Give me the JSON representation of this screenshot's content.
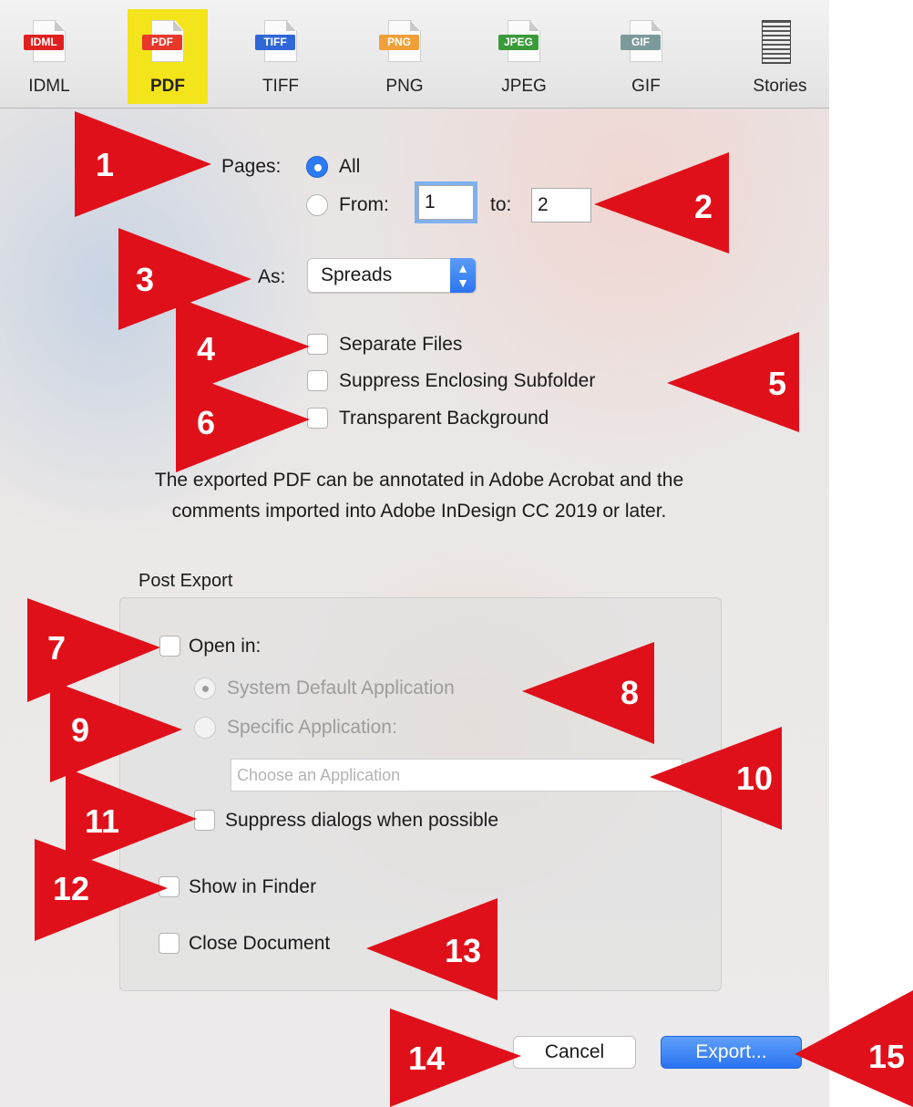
{
  "toolbar": {
    "items": [
      {
        "badge": "IDML",
        "badge_color": "#e0201f",
        "label": "IDML"
      },
      {
        "badge": "PDF",
        "badge_color": "#e8382a",
        "label": "PDF"
      },
      {
        "badge": "TIFF",
        "badge_color": "#2f67d8",
        "label": "TIFF"
      },
      {
        "badge": "PNG",
        "badge_color": "#f0a03a",
        "label": "PNG"
      },
      {
        "badge": "JPEG",
        "badge_color": "#3a9a3a",
        "label": "JPEG"
      },
      {
        "badge": "GIF",
        "badge_color": "#7d9a9a",
        "label": "GIF"
      },
      {
        "badge": "",
        "badge_color": "",
        "label": "Stories"
      }
    ],
    "selected": "PDF",
    "selected_color": "#f3e41b"
  },
  "pages": {
    "label": "Pages:",
    "all_label": "All",
    "from_label": "From:",
    "from_value": "1",
    "to_label": "to:",
    "to_value": "2",
    "selected": "All"
  },
  "as": {
    "label": "As:",
    "value": "Spreads"
  },
  "options": {
    "separate_files": "Separate Files",
    "suppress_subfolder": "Suppress Enclosing Subfolder",
    "transparent_bg": "Transparent Background"
  },
  "note": {
    "line1": "The exported PDF can be annotated in Adobe Acrobat and the",
    "line2": "comments imported into Adobe InDesign CC 2019 or later."
  },
  "post_export": {
    "title": "Post Export",
    "open_in": "Open in:",
    "system_default": "System Default Application",
    "specific_app": "Specific Application:",
    "app_placeholder": "Choose an Application",
    "suppress_dialogs": "Suppress dialogs when possible",
    "show_in_finder": "Show in Finder",
    "close_document": "Close Document"
  },
  "buttons": {
    "cancel": "Cancel",
    "export": "Export..."
  },
  "callouts": {
    "color": "#e0101a",
    "numbers": [
      "1",
      "2",
      "3",
      "4",
      "5",
      "6",
      "7",
      "8",
      "9",
      "10",
      "11",
      "12",
      "13",
      "14",
      "15"
    ]
  }
}
